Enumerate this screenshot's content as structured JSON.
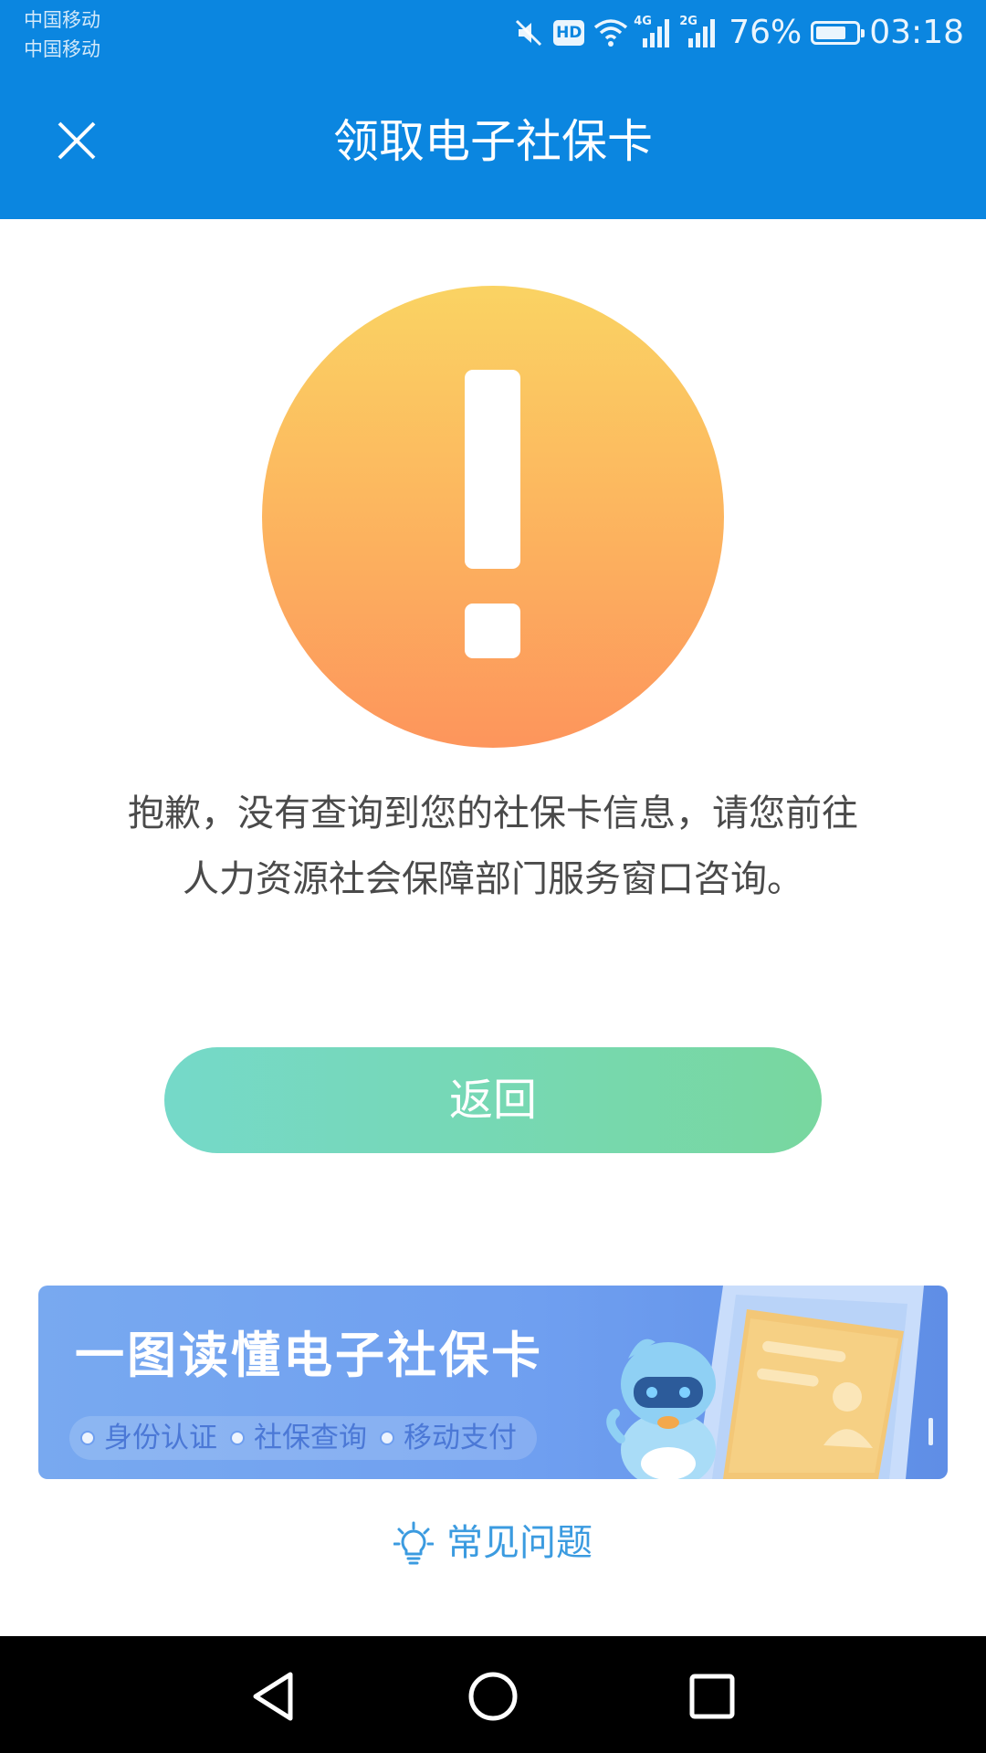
{
  "status_bar": {
    "carrier_1": "中国移动",
    "carrier_2": "中国移动",
    "hd_label": "HD",
    "network_1": "4G",
    "network_2": "2G",
    "battery_percent": "76%",
    "battery_level": 0.76,
    "time": "03:18"
  },
  "header": {
    "title": "领取电子社保卡",
    "close_icon": "close-icon",
    "background": "#0b86e0"
  },
  "main": {
    "alert_icon": "exclamation-icon",
    "message_line_1": "抱歉，没有查询到您的社保卡信息，请您前往",
    "message_line_2": "人力资源社会保障部门服务窗口咨询。",
    "back_button_label": "返回"
  },
  "banner": {
    "title": "一图读懂电子社保卡",
    "tags": [
      "身份认证",
      "社保查询",
      "移动支付"
    ]
  },
  "faq": {
    "icon": "lightbulb-icon",
    "label": "常见问题"
  },
  "colors": {
    "accent": "#0b86e0",
    "button_start": "#75d9c9",
    "button_end": "#78d79f",
    "alert_top": "#fad363",
    "alert_bottom": "#fd955c",
    "link": "#3b9be0"
  }
}
